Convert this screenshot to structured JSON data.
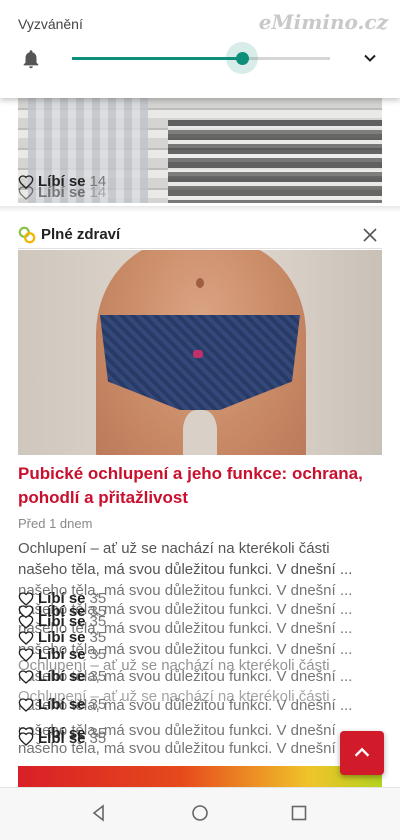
{
  "volume": {
    "label": "Vyzvánění",
    "level_percent": 66,
    "accent": "#0e8f7a"
  },
  "watermark": "eMimino.cz",
  "top_item": {
    "likes_label": "Líbí se",
    "likes_count": "14"
  },
  "card": {
    "source": "Plné zdraví",
    "headline": "Pubické ochlupení a jeho funkce: ochrana, pohodlí a přitažlivost",
    "date": "Před 1 dnem",
    "excerpt_1": "Ochlupení – ať už se nachází na kterékoli části",
    "excerpt_2": "našeho těla, má svou důležitou funkci. V dnešní ..."
  },
  "likes": {
    "label": "Líbí se",
    "count": "35"
  },
  "colors": {
    "headline": "#c8102e",
    "fab": "#d11a2a"
  }
}
